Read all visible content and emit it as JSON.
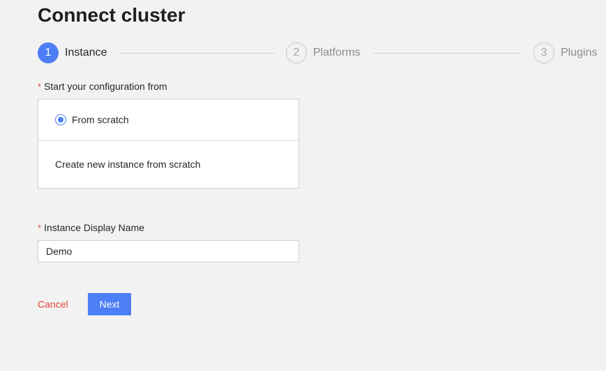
{
  "page": {
    "title": "Connect cluster"
  },
  "steps": [
    {
      "number": "1",
      "label": "Instance",
      "state": "active"
    },
    {
      "number": "2",
      "label": "Platforms",
      "state": "inactive"
    },
    {
      "number": "3",
      "label": "Plugins",
      "state": "inactive"
    }
  ],
  "config": {
    "required_mark": "*",
    "label": "Start your configuration from",
    "option_label": "From scratch",
    "option_selected": true,
    "option_description": "Create new instance from scratch"
  },
  "display_name": {
    "required_mark": "*",
    "label": "Instance Display Name",
    "value": "Demo"
  },
  "actions": {
    "cancel_label": "Cancel",
    "next_label": "Next"
  },
  "colors": {
    "accent": "#4c7ef5",
    "danger": "#e0443b",
    "background": "#f2f2f2"
  }
}
